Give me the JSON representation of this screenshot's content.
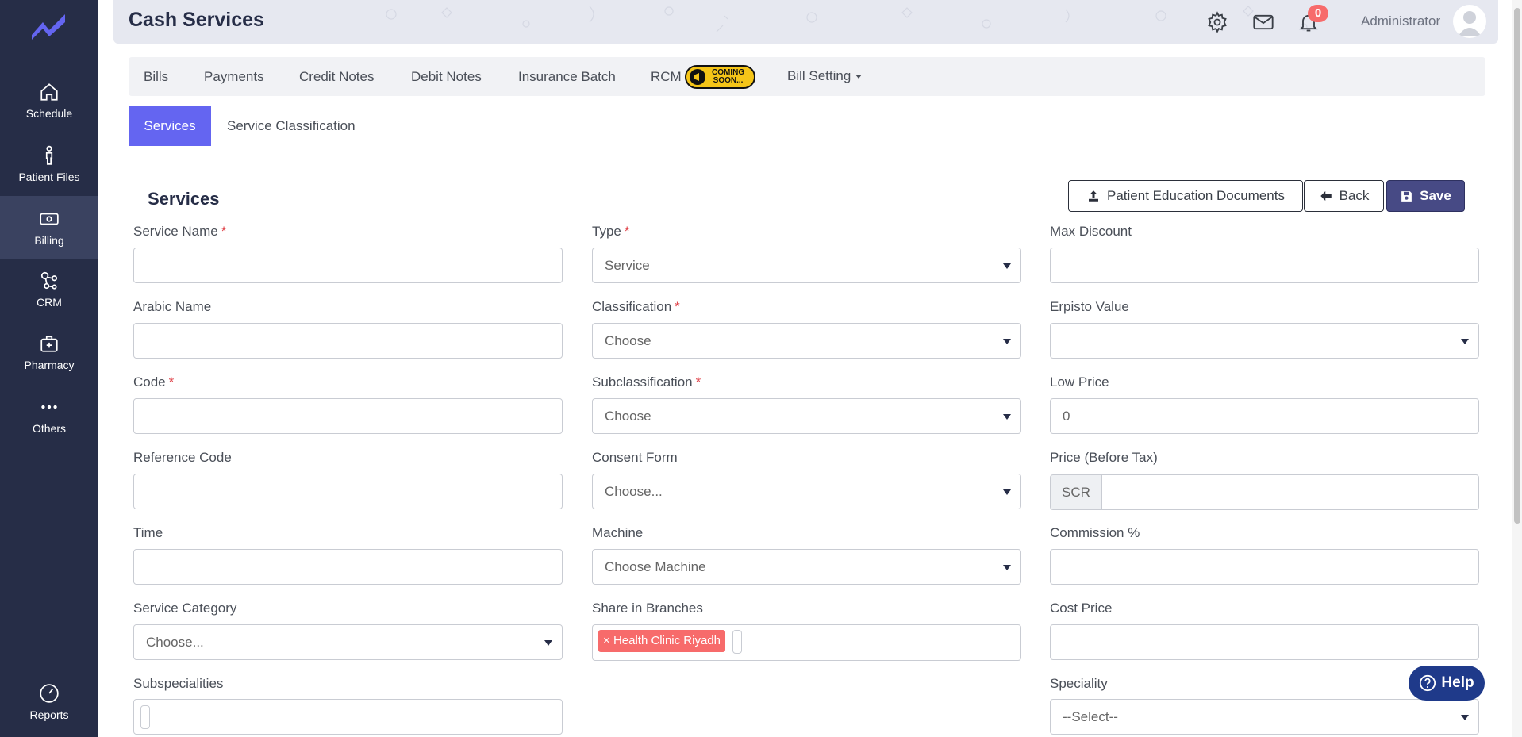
{
  "sidebar": {
    "items": [
      {
        "label": "Schedule",
        "icon": "home-icon"
      },
      {
        "label": "Patient Files",
        "icon": "person-icon"
      },
      {
        "label": "Billing",
        "icon": "money-icon"
      },
      {
        "label": "CRM",
        "icon": "network-icon"
      },
      {
        "label": "Pharmacy",
        "icon": "medical-bag-icon"
      },
      {
        "label": "Others",
        "icon": "more-dots-icon"
      },
      {
        "label": "Reports",
        "icon": "gauge-icon"
      }
    ]
  },
  "header": {
    "title": "Cash Services",
    "notification_count": "0",
    "user": "Administrator"
  },
  "tabs": {
    "bills": "Bills",
    "payments": "Payments",
    "credit_notes": "Credit Notes",
    "debit_notes": "Debit Notes",
    "insurance_batch": "Insurance Batch",
    "rcm": "RCM",
    "coming_soon_line1": "COMING",
    "coming_soon_line2": "SOON...",
    "bill_setting": "Bill Setting"
  },
  "subtabs": {
    "services": "Services",
    "service_classification": "Service Classification"
  },
  "section_title": "Services",
  "buttons": {
    "patient_education": "Patient Education Documents",
    "back": "Back",
    "save": "Save",
    "help": "Help"
  },
  "form": {
    "service_name": {
      "label": "Service Name",
      "required": "*",
      "value": ""
    },
    "arabic_name": {
      "label": "Arabic Name",
      "value": ""
    },
    "code": {
      "label": "Code",
      "required": "*",
      "value": ""
    },
    "reference_code": {
      "label": "Reference Code",
      "value": ""
    },
    "time": {
      "label": "Time",
      "value": ""
    },
    "service_category": {
      "label": "Service Category",
      "value": "Choose..."
    },
    "subspecialities": {
      "label": "Subspecialities",
      "value": ""
    },
    "type": {
      "label": "Type",
      "required": "*",
      "value": "Service"
    },
    "classification": {
      "label": "Classification",
      "required": "*",
      "value": "Choose"
    },
    "subclassification": {
      "label": "Subclassification",
      "required": "*",
      "value": "Choose"
    },
    "consent_form": {
      "label": "Consent Form",
      "value": "Choose..."
    },
    "machine": {
      "label": "Machine",
      "value": "Choose Machine"
    },
    "share_in_branches": {
      "label": "Share in Branches",
      "tags": [
        "Health Clinic Riyadh"
      ]
    },
    "max_discount": {
      "label": "Max Discount",
      "value": ""
    },
    "erpisto_value": {
      "label": "Erpisto Value",
      "value": ""
    },
    "low_price": {
      "label": "Low Price",
      "value": "0"
    },
    "price_before_tax": {
      "label": "Price (Before Tax)",
      "currency": "SCR",
      "value": ""
    },
    "commission": {
      "label": "Commission %",
      "value": ""
    },
    "cost_price": {
      "label": "Cost Price",
      "value": ""
    },
    "speciality": {
      "label": "Speciality",
      "value": "--Select--"
    }
  },
  "colors": {
    "sidebar": "#262d47",
    "accent": "#6465f1",
    "save": "#474a85",
    "tag": "#f76b6b",
    "help": "#1f3a8a"
  }
}
